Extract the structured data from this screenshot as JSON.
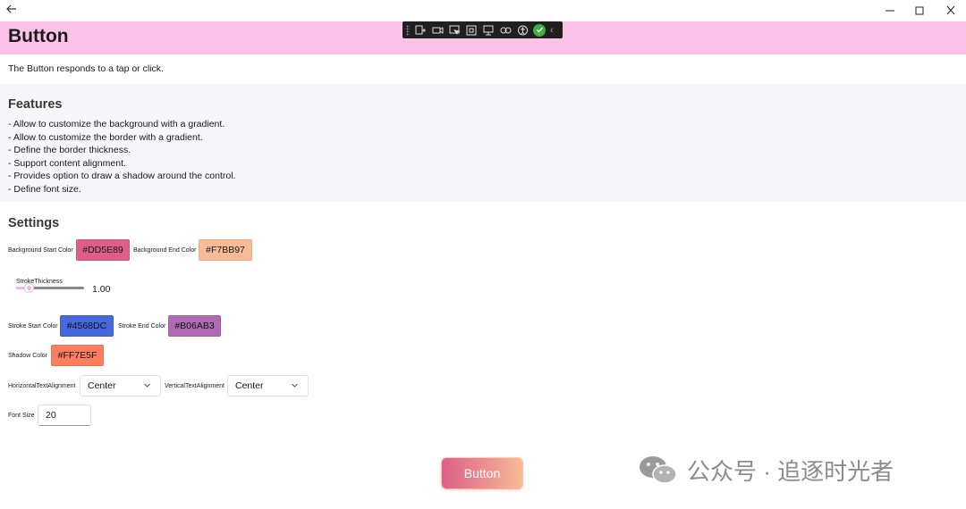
{
  "window": {
    "back_icon": "arrow-left-icon",
    "minimize_icon": "minimize-icon",
    "maximize_icon": "maximize-icon",
    "close_icon": "close-icon"
  },
  "header": {
    "title": "Button",
    "background": "#FCC3E8"
  },
  "devtools": {
    "icons": [
      "live-visual-tree-icon",
      "record-icon",
      "select-element-icon",
      "display-layout-icon",
      "track-focus-icon",
      "binding-failures-icon",
      "accessibility-icon",
      "hot-reload-ok-icon",
      "collapse-chevron-icon"
    ]
  },
  "description": "The Button responds to a tap or click.",
  "features": {
    "title": "Features",
    "items": [
      "- Allow to customize the background with a gradient.",
      "- Allow to customize the border with a gradient.",
      "- Define the border thickness.",
      "- Support content alignment.",
      "- Provides option to draw a shadow around the control.",
      "- Define font size."
    ]
  },
  "settings": {
    "title": "Settings",
    "bg_start_label": "Background Start Color",
    "bg_start_value": "#DD5E89",
    "bg_end_label": "Background End Color",
    "bg_end_value": "#F7BB97",
    "stroke_thickness_label": "StrokeThickness",
    "stroke_thickness_value": "1.00",
    "stroke_thickness_fraction": 0.1,
    "stroke_start_label": "Stroke Start Color",
    "stroke_start_value": "#4568DC",
    "stroke_end_label": "Stroke End Color",
    "stroke_end_value": "#B06AB3",
    "shadow_label": "Shadow Color",
    "shadow_value": "#FF7E5F",
    "h_align_label": "HorizontalTextAlignment",
    "h_align_value": "Center",
    "v_align_label": "VerticalTextAlignment",
    "v_align_value": "Center",
    "font_size_label": "Font Size",
    "font_size_value": "20"
  },
  "demo": {
    "button_label": "Button"
  },
  "watermark": {
    "text": "公众号 · 追逐时光者",
    "icon": "wechat-logo-icon"
  }
}
